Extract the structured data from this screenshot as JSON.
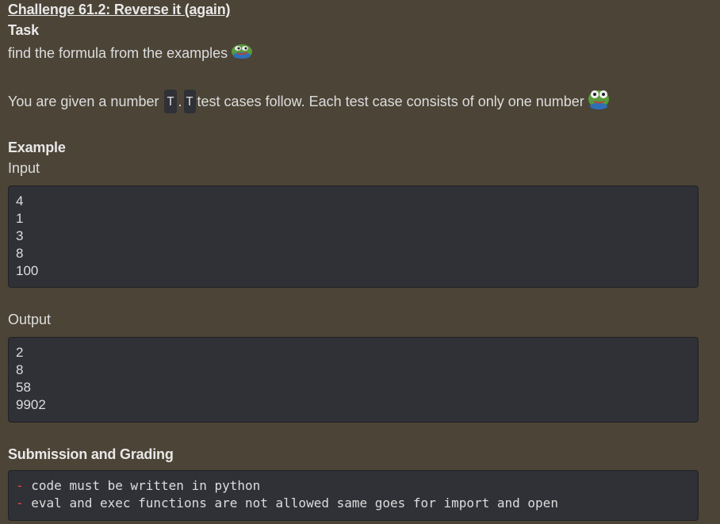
{
  "challenge": {
    "title": "Challenge 61.2: Reverse it (again)",
    "task_heading": "Task",
    "task_text": "find the formula from the examples",
    "given_prefix": "You are given a number",
    "given_code_1": "T",
    "given_dot": ".",
    "given_code_2": "T",
    "given_suffix": "test cases follow. Each test case consists of only one number",
    "example_heading": "Example",
    "input_label": "Input",
    "input_lines": [
      "4",
      "1",
      "3",
      "8",
      "100"
    ],
    "output_label": "Output",
    "output_lines": [
      "2",
      "8",
      "58",
      "9902"
    ],
    "submission_heading": "Submission and Grading",
    "rules": [
      {
        "dash": "-",
        "text": "code must be written in python"
      },
      {
        "dash": "-",
        "text": "eval and exec functions are not allowed same goes for import and open"
      }
    ]
  },
  "emojis": {
    "task_emoji": "frog-emoji",
    "given_emoji": "frog-stare-emoji"
  },
  "colors": {
    "background": "#4c4436",
    "code_background": "#2f3136",
    "text": "#dcddde",
    "dash": "#f04747"
  }
}
